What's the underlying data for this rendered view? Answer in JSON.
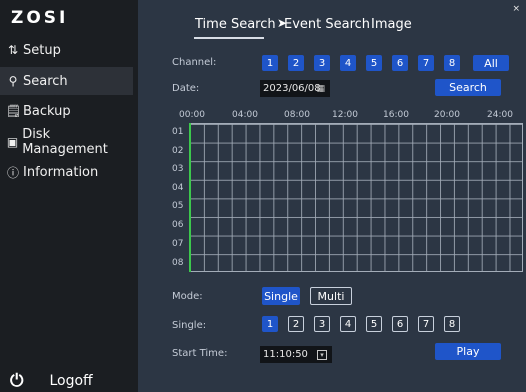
{
  "brand": "ZOSI",
  "sidebar": {
    "items": [
      {
        "icon": "sliders-icon",
        "icon_glyph": "⇅",
        "label": "Setup"
      },
      {
        "icon": "search-icon",
        "icon_glyph": "⚲",
        "label": "Search"
      },
      {
        "icon": "backup-icon",
        "icon_glyph": "🗒",
        "label": "Backup"
      },
      {
        "icon": "disk-icon",
        "icon_glyph": "▣",
        "label": "Disk Management"
      },
      {
        "icon": "info-icon",
        "icon_glyph": "ⓘ",
        "label": "Information"
      }
    ],
    "active": "Search",
    "logoff": {
      "icon": "power-icon",
      "icon_glyph": "⏻",
      "label": "Logoff"
    }
  },
  "tabs": [
    {
      "label": "Time Search",
      "active": true
    },
    {
      "label": "Event Search",
      "active": false
    },
    {
      "label": "Image",
      "active": false
    }
  ],
  "close_glyph": "×",
  "form": {
    "channel_label": "Channel:",
    "channels": [
      "1",
      "2",
      "3",
      "4",
      "5",
      "6",
      "7",
      "8"
    ],
    "all_label": "All",
    "date_label": "Date:",
    "date_value": "2023/06/08",
    "calendar_icon": "calendar-icon",
    "calendar_glyph": "▦",
    "search_label": "Search",
    "timeline": {
      "hours": [
        "00:00",
        "04:00",
        "08:00",
        "12:00",
        "16:00",
        "20:00",
        "24:00"
      ],
      "rows": [
        "01",
        "02",
        "03",
        "04",
        "05",
        "06",
        "07",
        "08"
      ]
    },
    "mode_label": "Mode:",
    "mode_single": "Single",
    "mode_multi": "Multi",
    "mode_selected": "Single",
    "single_label": "Single:",
    "single_channels": [
      "1",
      "2",
      "3",
      "4",
      "5",
      "6",
      "7",
      "8"
    ],
    "single_selected": "1",
    "start_time_label": "Start Time:",
    "start_time_value": "11:10:50",
    "time_icon_glyph": "▾",
    "play_label": "Play"
  },
  "colors": {
    "accent": "#1f55c9",
    "sidebar_bg": "#1b1e22",
    "main_bg": "#2c3644",
    "timeline_marker": "#3cc84d"
  }
}
